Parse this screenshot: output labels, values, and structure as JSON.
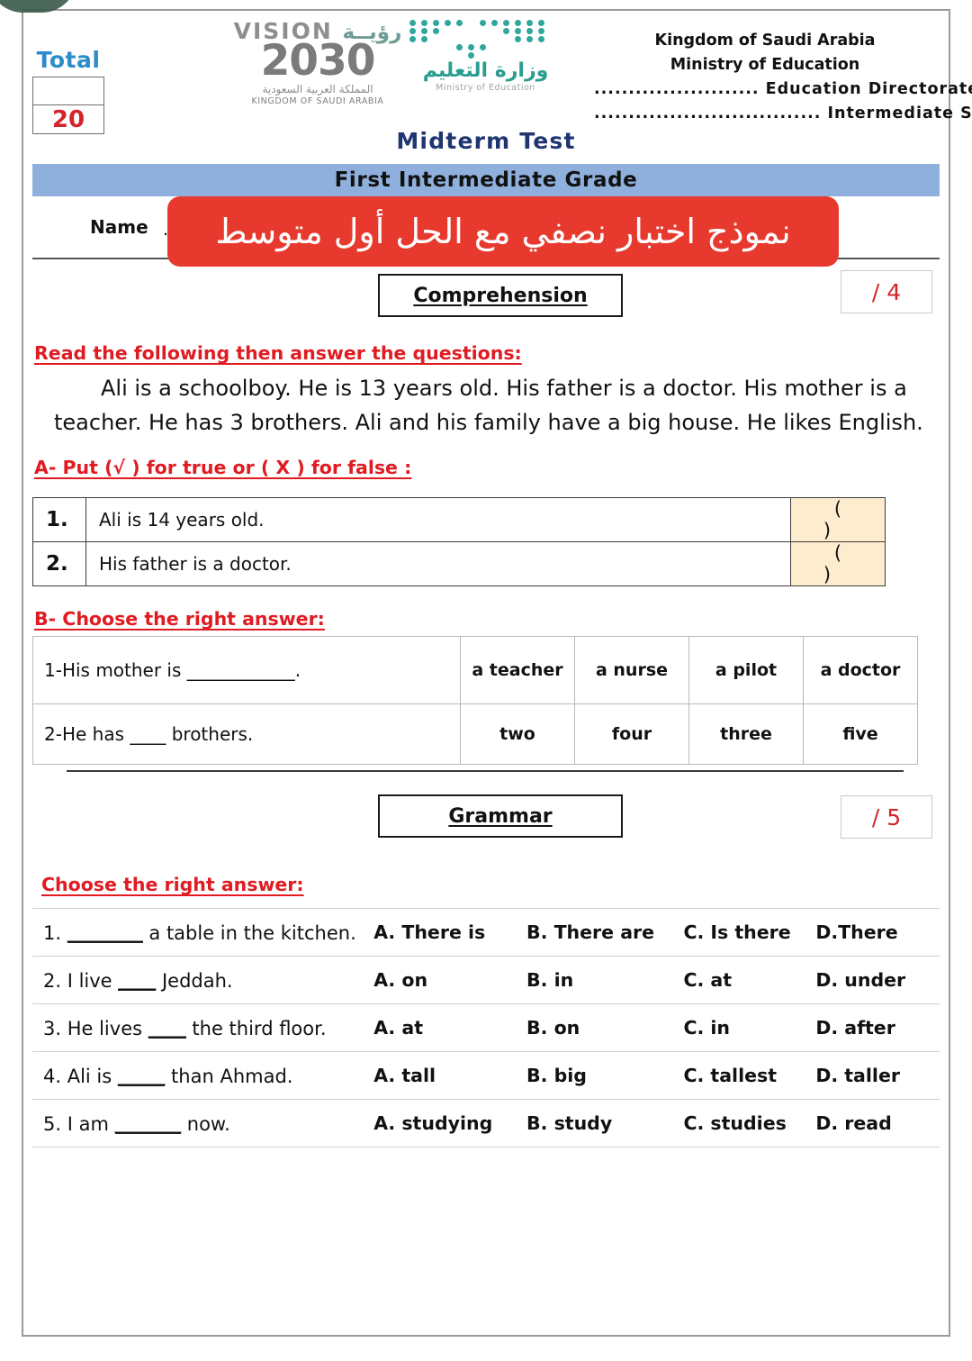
{
  "corner": {
    "icon": "green-tab-shape"
  },
  "header": {
    "total_label": "Total",
    "total_blank": "",
    "total_value": "20",
    "vision_logo": {
      "word_en": "VISION",
      "word_ar": "رؤيــة",
      "year": "2030",
      "sub_ar": "المملكة العربية السعودية",
      "sub_en": "KINGDOM OF SAUDI ARABIA"
    },
    "moe_logo": {
      "name_ar": "وزارة التعليم",
      "name_en": "Ministry of Education"
    },
    "right_block": [
      "Kingdom of Saudi Arabia",
      "Ministry of Education",
      "........................ Education Directorate",
      "................................. Intermediate School"
    ],
    "exam_title": "Midterm Test",
    "grade_bar": "First Intermediate Grade",
    "name_label": "Name",
    "name_dots": "..............................................................................",
    "red_banner_ar": "نموذج اختبار نصفي مع الحل أول متوسط"
  },
  "comprehension": {
    "section_title": "Comprehension",
    "mark": "/ 4",
    "read_instruction": "Read the following then answer the questions:",
    "passage": "Ali is a schoolboy. He is 13 years old. His father is a doctor. His mother is a teacher. He has 3 brothers. Ali and his family have a big house. He likes English.",
    "part_a_instruction": "A- Put (√ ) for true or ( X ) for false :",
    "true_false": [
      {
        "num": "1.",
        "statement": "Ali is 14 years old.",
        "answer": "(    )"
      },
      {
        "num": "2.",
        "statement": "His father is a doctor.",
        "answer": "(    )"
      }
    ],
    "part_b_instruction": "B- Choose the right answer:",
    "choices": [
      {
        "question": "1-His mother is ____________.",
        "options": [
          "a teacher",
          "a nurse",
          "a pilot",
          "a doctor"
        ]
      },
      {
        "question": "2-He has ____ brothers.",
        "options": [
          "two",
          "four",
          "three",
          "five"
        ]
      }
    ]
  },
  "grammar": {
    "section_title": "Grammar",
    "mark": "/ 5",
    "instruction": "Choose the right answer:",
    "questions": [
      {
        "text_before": "1. ",
        "blank": "________",
        "text_after": " a table in the kitchen.",
        "options": [
          "A. There is",
          "B. There are",
          "C. Is there",
          "D.There"
        ]
      },
      {
        "text_before": "2. I live ",
        "blank": "____",
        "text_after": " Jeddah.",
        "options": [
          "A. on",
          "B. in",
          "C. at",
          "D. under"
        ]
      },
      {
        "text_before": "3. He lives  ",
        "blank": "____",
        "text_after": " the third floor.",
        "options": [
          "A. at",
          "B. on",
          "C. in",
          "D. after"
        ]
      },
      {
        "text_before": "4. Ali is ",
        "blank": "_____",
        "text_after": " than Ahmad.",
        "options": [
          "A. tall",
          "B. big",
          "C. tallest",
          "D. taller"
        ]
      },
      {
        "text_before": "5. I am ",
        "blank": "_______",
        "text_after": " now.",
        "options": [
          "A. studying",
          "B. study",
          "C. studies",
          "D. read"
        ]
      }
    ]
  },
  "colors": {
    "accent_red": "#e01b22",
    "banner_red": "#e8392e",
    "grade_blue": "#8fb0dc",
    "title_navy": "#1f3570",
    "total_blue": "#2b8ccc",
    "answer_cell": "#fdeccd",
    "moe_teal": "#2a9d8f"
  }
}
